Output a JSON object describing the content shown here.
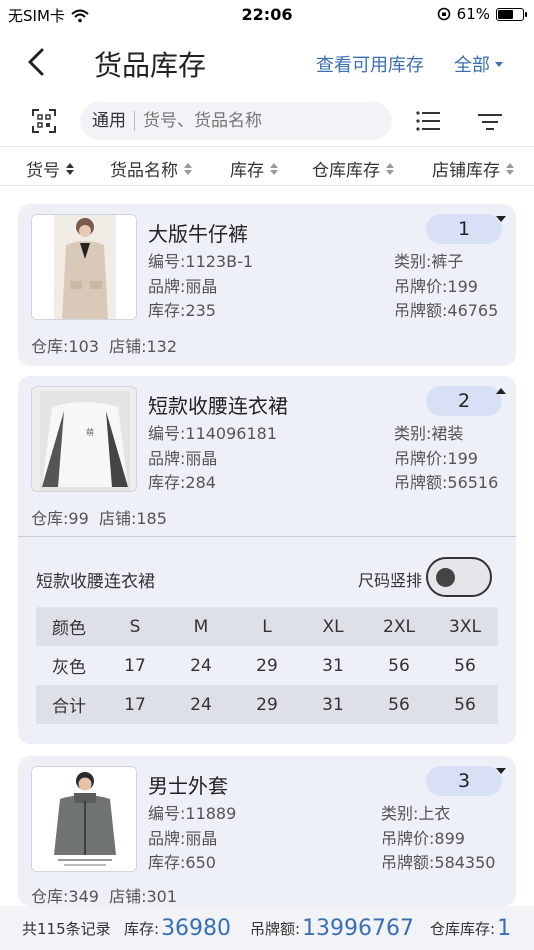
{
  "status_bar": {
    "carrier": "无SIM卡",
    "time": "22:06",
    "battery": "61%"
  },
  "nav": {
    "title": "货品库存",
    "available_stock_link": "查看可用库存",
    "filter_label": "全部"
  },
  "search": {
    "type_label": "通用",
    "placeholder": "货号、货品名称"
  },
  "sort_columns": [
    "货号",
    "货品名称",
    "库存",
    "仓库库存",
    "店铺库存"
  ],
  "products": [
    {
      "index": "1",
      "name": "大版牛仔裤",
      "code": "编号:1123B-1",
      "brand": "品牌:丽晶",
      "stock": "库存:235",
      "category": "类别:裤子",
      "tag_price": "吊牌价:199",
      "tag_amount": "吊牌额:46765",
      "warehouse": "仓库:103",
      "store": "店铺:132"
    },
    {
      "index": "2",
      "name": "短款收腰连衣裙",
      "code": "编号:114096181",
      "brand": "品牌:丽晶",
      "stock": "库存:284",
      "category": "类别:裙装",
      "tag_price": "吊牌价:199",
      "tag_amount": "吊牌额:56516",
      "warehouse": "仓库:99",
      "store": "店铺:185",
      "detail": {
        "name": "短款收腰连衣裙",
        "toggle_label": "尺码竖排",
        "toggle_on": false,
        "header": [
          "颜色",
          "S",
          "M",
          "L",
          "XL",
          "2XL",
          "3XL"
        ],
        "rows": [
          [
            "灰色",
            "17",
            "24",
            "29",
            "31",
            "56",
            "56"
          ],
          [
            "合计",
            "17",
            "24",
            "29",
            "31",
            "56",
            "56"
          ]
        ]
      }
    },
    {
      "index": "3",
      "name": "男士外套",
      "code": "编号:11889",
      "brand": "品牌:丽晶",
      "stock": "库存:650",
      "category": "类别:上衣",
      "tag_price": "吊牌价:899",
      "tag_amount": "吊牌额:584350",
      "warehouse": "仓库:349",
      "store": "店铺:301"
    }
  ],
  "footer": {
    "records": "共115条记录",
    "stock_label": "库存:",
    "stock_value": "36980",
    "amount_label": "吊牌额:",
    "amount_value": "13996767",
    "warehouse_label": "仓库库存:",
    "warehouse_value": "1"
  },
  "colors": {
    "accent": "#3a6fb5",
    "card_bg": "#eef0f8",
    "badge_bg": "#d8e0f5"
  }
}
